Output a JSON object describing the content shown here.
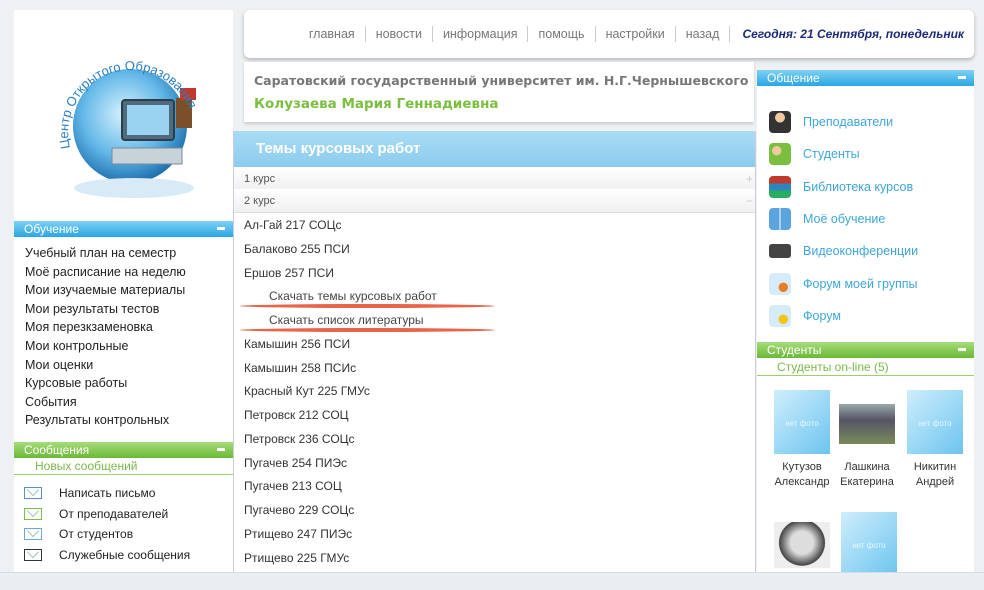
{
  "logo": {
    "arc_text": "Центр Открытого Образования"
  },
  "nav": {
    "links": [
      "главная",
      "новости",
      "информация",
      "помощь",
      "настройки",
      "назад"
    ],
    "today": "Сегодня: 21 Сентября, понедельник"
  },
  "header": {
    "university": "Саратовский государственный университет им. Н.Г.Чернышевского",
    "user_name": "Колузаева Мария Геннадиевна"
  },
  "left": {
    "learning_title": "Обучение",
    "learning_items": [
      "Учебный план на семестр",
      "Моё расписание на неделю",
      "Мои изучаемые материалы",
      "Мои результаты тестов",
      "Моя перезкзаменовка",
      "Мои контрольные",
      "Мои оценки",
      "Курсовые работы",
      "События",
      "Результаты контрольных"
    ],
    "messages_title": "Сообщения",
    "new_messages": "Новых сообщений",
    "message_items": [
      "Написать письмо",
      "От преподавателей",
      "От студентов",
      "Служебные сообщения"
    ]
  },
  "main": {
    "title": "Темы курсовых работ",
    "course1": "1 курс",
    "course2": "2 курс",
    "groups": [
      "Ал-Гай 217 СОЦс",
      "Балаково 255 ПСИ",
      "Ершов 257 ПСИ",
      "Скачать темы курсовых работ",
      "Скачать список литературы",
      "Камышин 256 ПСИ",
      "Камышин 258 ПСИс",
      "Красный Кут 225 ГМУс",
      "Петровск 212 СОЦ",
      "Петровск 236 СОЦс",
      "Пугачев 254 ПИЭс",
      "Пугачев 213 СОЦ",
      "Пугачево 229 СОЦс",
      "Ртищево 247 ПИЭс",
      "Ртищево 225 ГМУс"
    ]
  },
  "right": {
    "communication_title": "Общение",
    "communication_items": [
      "Преподаватели",
      "Студенты",
      "Библиотека курсов",
      "Моё обучение",
      "Видеоконференции",
      "Форум моей группы",
      "Форум"
    ],
    "students_title": "Студенты",
    "online": "Студенты on-line (5)",
    "students": [
      {
        "first": "Кутузов",
        "second": "Александр"
      },
      {
        "first": "Лашкина",
        "second": "Екатерина"
      },
      {
        "first": "Никитин",
        "second": "Андрей"
      }
    ],
    "no_photo_label": "нет фото"
  },
  "colors": {
    "accent_blue": "#2aa6e4",
    "accent_green": "#6ab837",
    "link_blue": "#3ea6d8",
    "user_green": "#7bbf3f",
    "today_navy": "#1a2a7a"
  }
}
